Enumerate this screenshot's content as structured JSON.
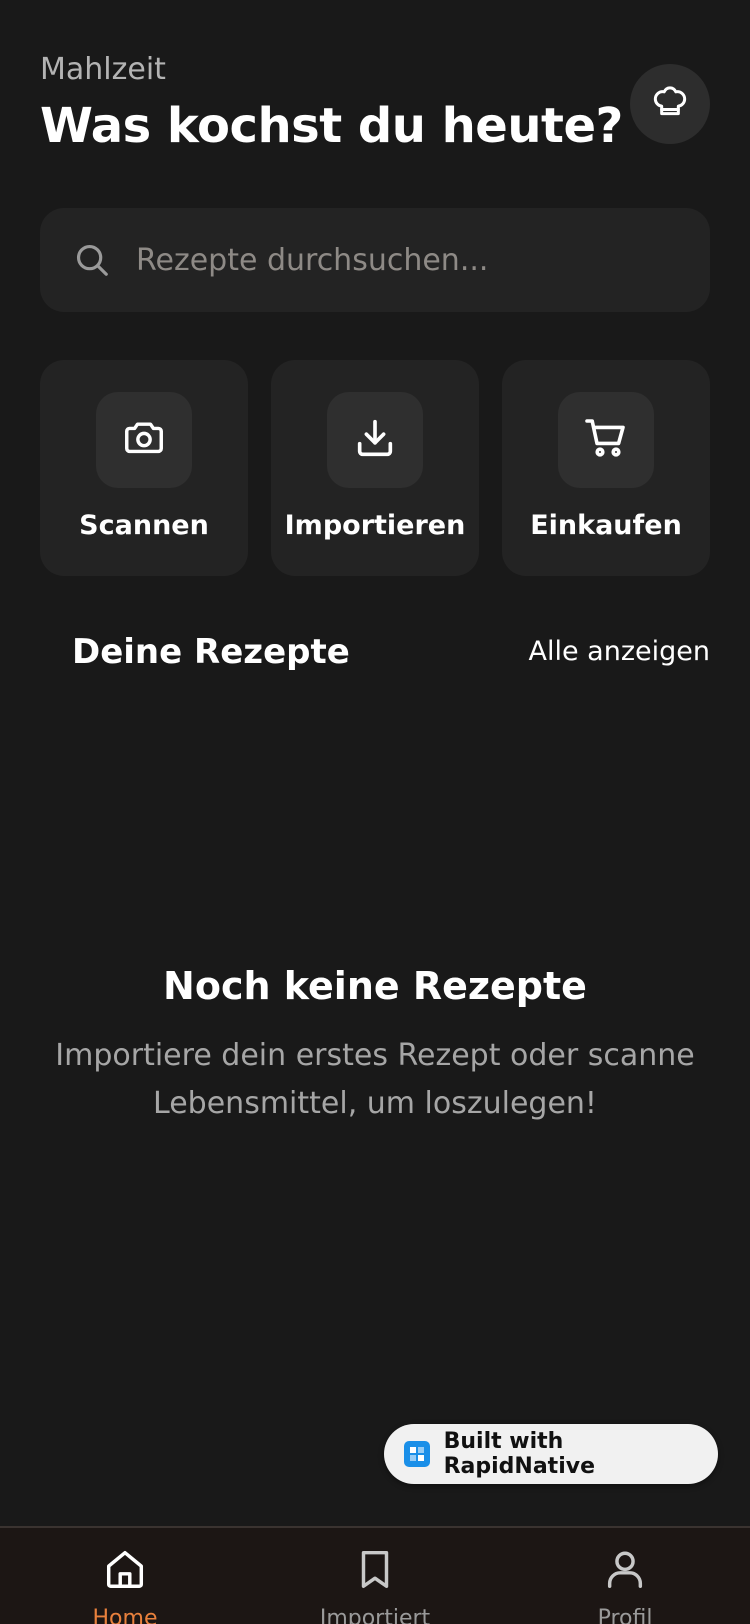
{
  "header": {
    "subtitle": "Mahlzeit",
    "title": "Was kochst du heute?",
    "profile_icon": "chef-hat-icon"
  },
  "search": {
    "placeholder": "Rezepte durchsuchen...",
    "value": "",
    "icon": "search-icon"
  },
  "actions": [
    {
      "label": "Scannen",
      "icon": "camera-icon"
    },
    {
      "label": "Importieren",
      "icon": "download-icon"
    },
    {
      "label": "Einkaufen",
      "icon": "cart-icon"
    }
  ],
  "recipes_section": {
    "title": "Deine Rezepte",
    "link": "Alle anzeigen"
  },
  "empty_state": {
    "title": "Noch keine Rezepte",
    "text": "Importiere dein erstes Rezept oder scanne Lebensmittel, um loszulegen!"
  },
  "badge": {
    "text": "Built with RapidNative"
  },
  "tabbar": {
    "tabs": [
      {
        "label": "Home",
        "icon": "home-icon",
        "active": true
      },
      {
        "label": "Importiert",
        "icon": "bookmark-icon",
        "active": false
      },
      {
        "label": "Profil",
        "icon": "user-icon",
        "active": false
      }
    ]
  },
  "colors": {
    "background": "#191919",
    "card": "#232323",
    "accent": "#e8803c",
    "muted_text": "#a6a6a6",
    "badge_logo": "#1a8fe8"
  }
}
